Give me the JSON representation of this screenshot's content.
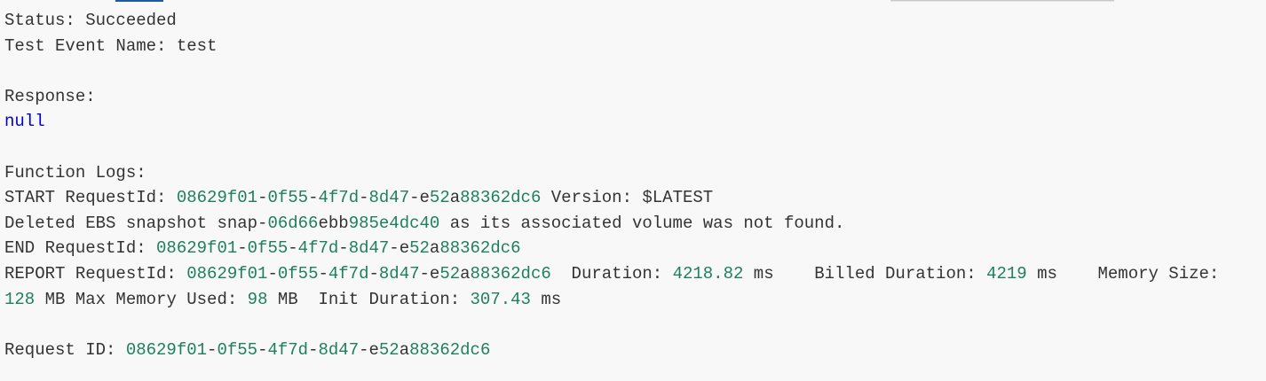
{
  "colors": {
    "text": "#333333",
    "number": "#1d7f5f",
    "keyword": "#0000cc"
  },
  "lines": [
    [
      [
        "Status: Succeeded",
        "t"
      ]
    ],
    [
      [
        "Test Event Name: test",
        "t"
      ]
    ],
    [],
    [
      [
        "Response:",
        "t"
      ]
    ],
    [
      [
        "null",
        "b"
      ]
    ],
    [],
    [
      [
        "Function Logs:",
        "t"
      ]
    ],
    [
      [
        "START RequestId: ",
        "t"
      ],
      [
        "08629f01",
        "g"
      ],
      [
        "-",
        "t"
      ],
      [
        "0f55",
        "g"
      ],
      [
        "-",
        "t"
      ],
      [
        "4f7d",
        "g"
      ],
      [
        "-",
        "t"
      ],
      [
        "8d47",
        "g"
      ],
      [
        "-e",
        "t"
      ],
      [
        "52",
        "g"
      ],
      [
        "a",
        "t"
      ],
      [
        "88362dc6",
        "g"
      ],
      [
        " Version: $LATEST",
        "t"
      ]
    ],
    [
      [
        "Deleted EBS snapshot snap-",
        "t"
      ],
      [
        "06d66",
        "g"
      ],
      [
        "ebb",
        "t"
      ],
      [
        "985e4dc40",
        "g"
      ],
      [
        " as its associated volume was not found.",
        "t"
      ]
    ],
    [
      [
        "END RequestId: ",
        "t"
      ],
      [
        "08629f01",
        "g"
      ],
      [
        "-",
        "t"
      ],
      [
        "0f55",
        "g"
      ],
      [
        "-",
        "t"
      ],
      [
        "4f7d",
        "g"
      ],
      [
        "-",
        "t"
      ],
      [
        "8d47",
        "g"
      ],
      [
        "-e",
        "t"
      ],
      [
        "52",
        "g"
      ],
      [
        "a",
        "t"
      ],
      [
        "88362dc6",
        "g"
      ]
    ],
    [
      [
        "REPORT RequestId: ",
        "t"
      ],
      [
        "08629f01",
        "g"
      ],
      [
        "-",
        "t"
      ],
      [
        "0f55",
        "g"
      ],
      [
        "-",
        "t"
      ],
      [
        "4f7d",
        "g"
      ],
      [
        "-",
        "t"
      ],
      [
        "8d47",
        "g"
      ],
      [
        "-e",
        "t"
      ],
      [
        "52",
        "g"
      ],
      [
        "a",
        "t"
      ],
      [
        "88362dc6",
        "g"
      ],
      [
        "  Duration: ",
        "t"
      ],
      [
        "4218.82",
        "g"
      ],
      [
        " ms    Billed Duration: ",
        "t"
      ],
      [
        "4219",
        "g"
      ],
      [
        " ms    Memory Size:",
        "t"
      ]
    ],
    [
      [
        "128",
        "g"
      ],
      [
        " MB Max Memory Used: ",
        "t"
      ],
      [
        "98",
        "g"
      ],
      [
        " MB  Init Duration: ",
        "t"
      ],
      [
        "307.43",
        "g"
      ],
      [
        " ms",
        "t"
      ]
    ],
    [],
    [
      [
        "Request ID: ",
        "t"
      ],
      [
        "08629f01",
        "g"
      ],
      [
        "-",
        "t"
      ],
      [
        "0f55",
        "g"
      ],
      [
        "-",
        "t"
      ],
      [
        "4f7d",
        "g"
      ],
      [
        "-",
        "t"
      ],
      [
        "8d47",
        "g"
      ],
      [
        "-e",
        "t"
      ],
      [
        "52",
        "g"
      ],
      [
        "a",
        "t"
      ],
      [
        "88362dc6",
        "g"
      ]
    ]
  ]
}
